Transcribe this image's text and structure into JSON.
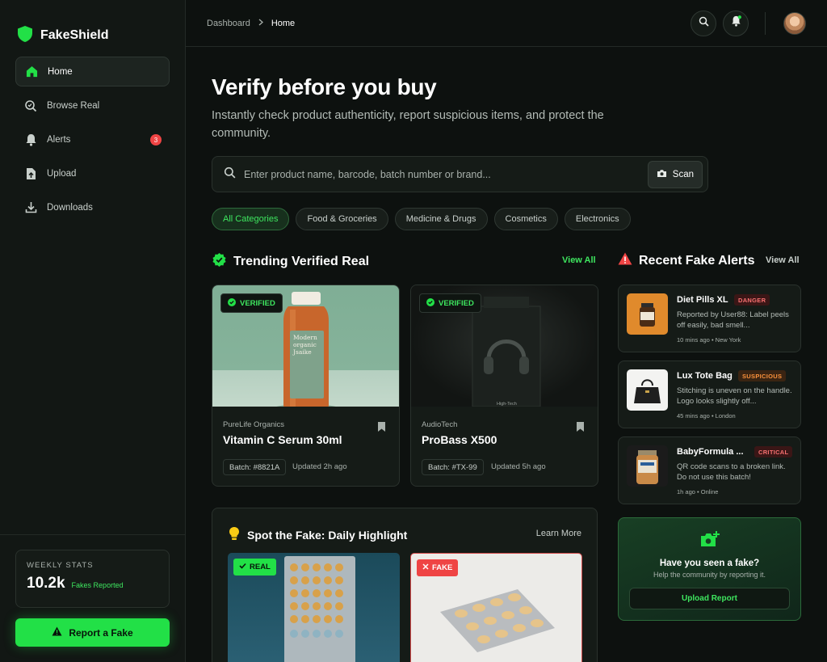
{
  "app": {
    "name": "FakeShield"
  },
  "sidebar": {
    "items": [
      {
        "label": "Home",
        "icon": "home-icon"
      },
      {
        "label": "Browse Real",
        "icon": "search-shield-icon"
      },
      {
        "label": "Alerts",
        "icon": "bell-icon",
        "badge": "3"
      },
      {
        "label": "Upload",
        "icon": "upload-icon"
      },
      {
        "label": "Downloads",
        "icon": "download-icon"
      }
    ],
    "stats": {
      "label": "WEEKLY STATS",
      "value": "10.2k",
      "sub": "Fakes Reported"
    },
    "report_label": "Report a Fake"
  },
  "topbar": {
    "breadcrumb": [
      "Dashboard",
      "Home"
    ]
  },
  "hero": {
    "title": "Verify before you buy",
    "subtitle": "Instantly check product authenticity, report suspicious items, and protect the community."
  },
  "search": {
    "placeholder": "Enter product name, barcode, batch number or brand...",
    "scan_label": "Scan"
  },
  "categories": [
    "All Categories",
    "Food & Groceries",
    "Medicine & Drugs",
    "Cosmetics",
    "Electronics"
  ],
  "trending": {
    "title": "Trending Verified Real",
    "view_all": "View All",
    "products": [
      {
        "badge": "VERIFIED",
        "brand": "PureLife Organics",
        "name": "Vitamin C Serum 30ml",
        "batch": "Batch: #8821A",
        "updated": "Updated 2h ago",
        "label_text": "Modern organic Jsaike"
      },
      {
        "badge": "VERIFIED",
        "brand": "AudioTech",
        "name": "ProBass X500",
        "batch": "Batch: #TX-99",
        "updated": "Updated 5h ago",
        "label_text": "High-Tech"
      }
    ]
  },
  "alerts": {
    "title": "Recent Fake Alerts",
    "view_all": "View All",
    "items": [
      {
        "title": "Diet Pills XL",
        "tag": "DANGER",
        "desc": "Reported by User88: Label peels off easily, bad smell...",
        "meta": "10 mins ago • New York",
        "tag_color": "#f87171"
      },
      {
        "title": "Lux Tote Bag",
        "tag": "SUSPICIOUS",
        "desc": "Stitching is uneven on the handle. Logo looks slightly off...",
        "meta": "45 mins ago • London",
        "tag_color": "#fb923c"
      },
      {
        "title": "BabyFormula ...",
        "tag": "CRITICAL",
        "desc": "QR code scans to a broken link. Do not use this batch!",
        "meta": "1h ago • Online",
        "tag_color": "#f87171"
      }
    ]
  },
  "cta": {
    "title": "Have you seen a fake?",
    "subtitle": "Help the community by reporting it.",
    "button": "Upload Report"
  },
  "spot": {
    "title": "Spot the Fake: Daily Highlight",
    "learn_more": "Learn More",
    "real_label": "REAL",
    "fake_label": "FAKE"
  },
  "colors": {
    "accent": "#22e047",
    "danger": "#ef4444",
    "background": "#0d110f"
  }
}
